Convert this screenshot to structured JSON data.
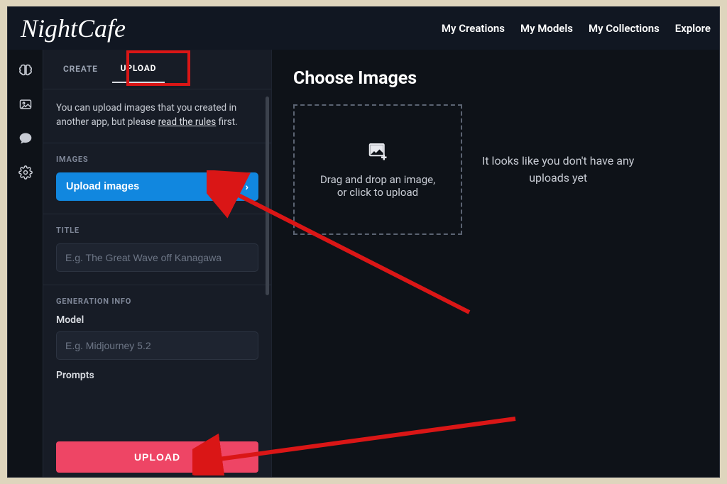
{
  "brand": "NightCafe",
  "nav": {
    "creations": "My Creations",
    "models": "My Models",
    "collections": "My Collections",
    "explore": "Explore"
  },
  "tabs": {
    "create": "CREATE",
    "upload": "UPLOAD"
  },
  "panel": {
    "help_prefix": "You can upload images that you created in another app, but please ",
    "help_link": "read the rules",
    "help_suffix": " first.",
    "images_label": "IMAGES",
    "upload_images_btn": "Upload images",
    "title_label": "TITLE",
    "title_placeholder": "E.g. The Great Wave off Kanagawa",
    "gen_info_label": "GENERATION INFO",
    "model_label": "Model",
    "model_placeholder": "E.g. Midjourney 5.2",
    "prompts_label": "Prompts",
    "submit_label": "UPLOAD"
  },
  "main": {
    "heading": "Choose Images",
    "dropzone_line1": "Drag and drop an image,",
    "dropzone_line2": "or click to upload",
    "empty_msg_line1": "It looks like you don't have any",
    "empty_msg_line2": "uploads yet"
  },
  "colors": {
    "accent_blue": "#1187df",
    "accent_pink": "#ee4565",
    "anno_red": "#da1616"
  }
}
